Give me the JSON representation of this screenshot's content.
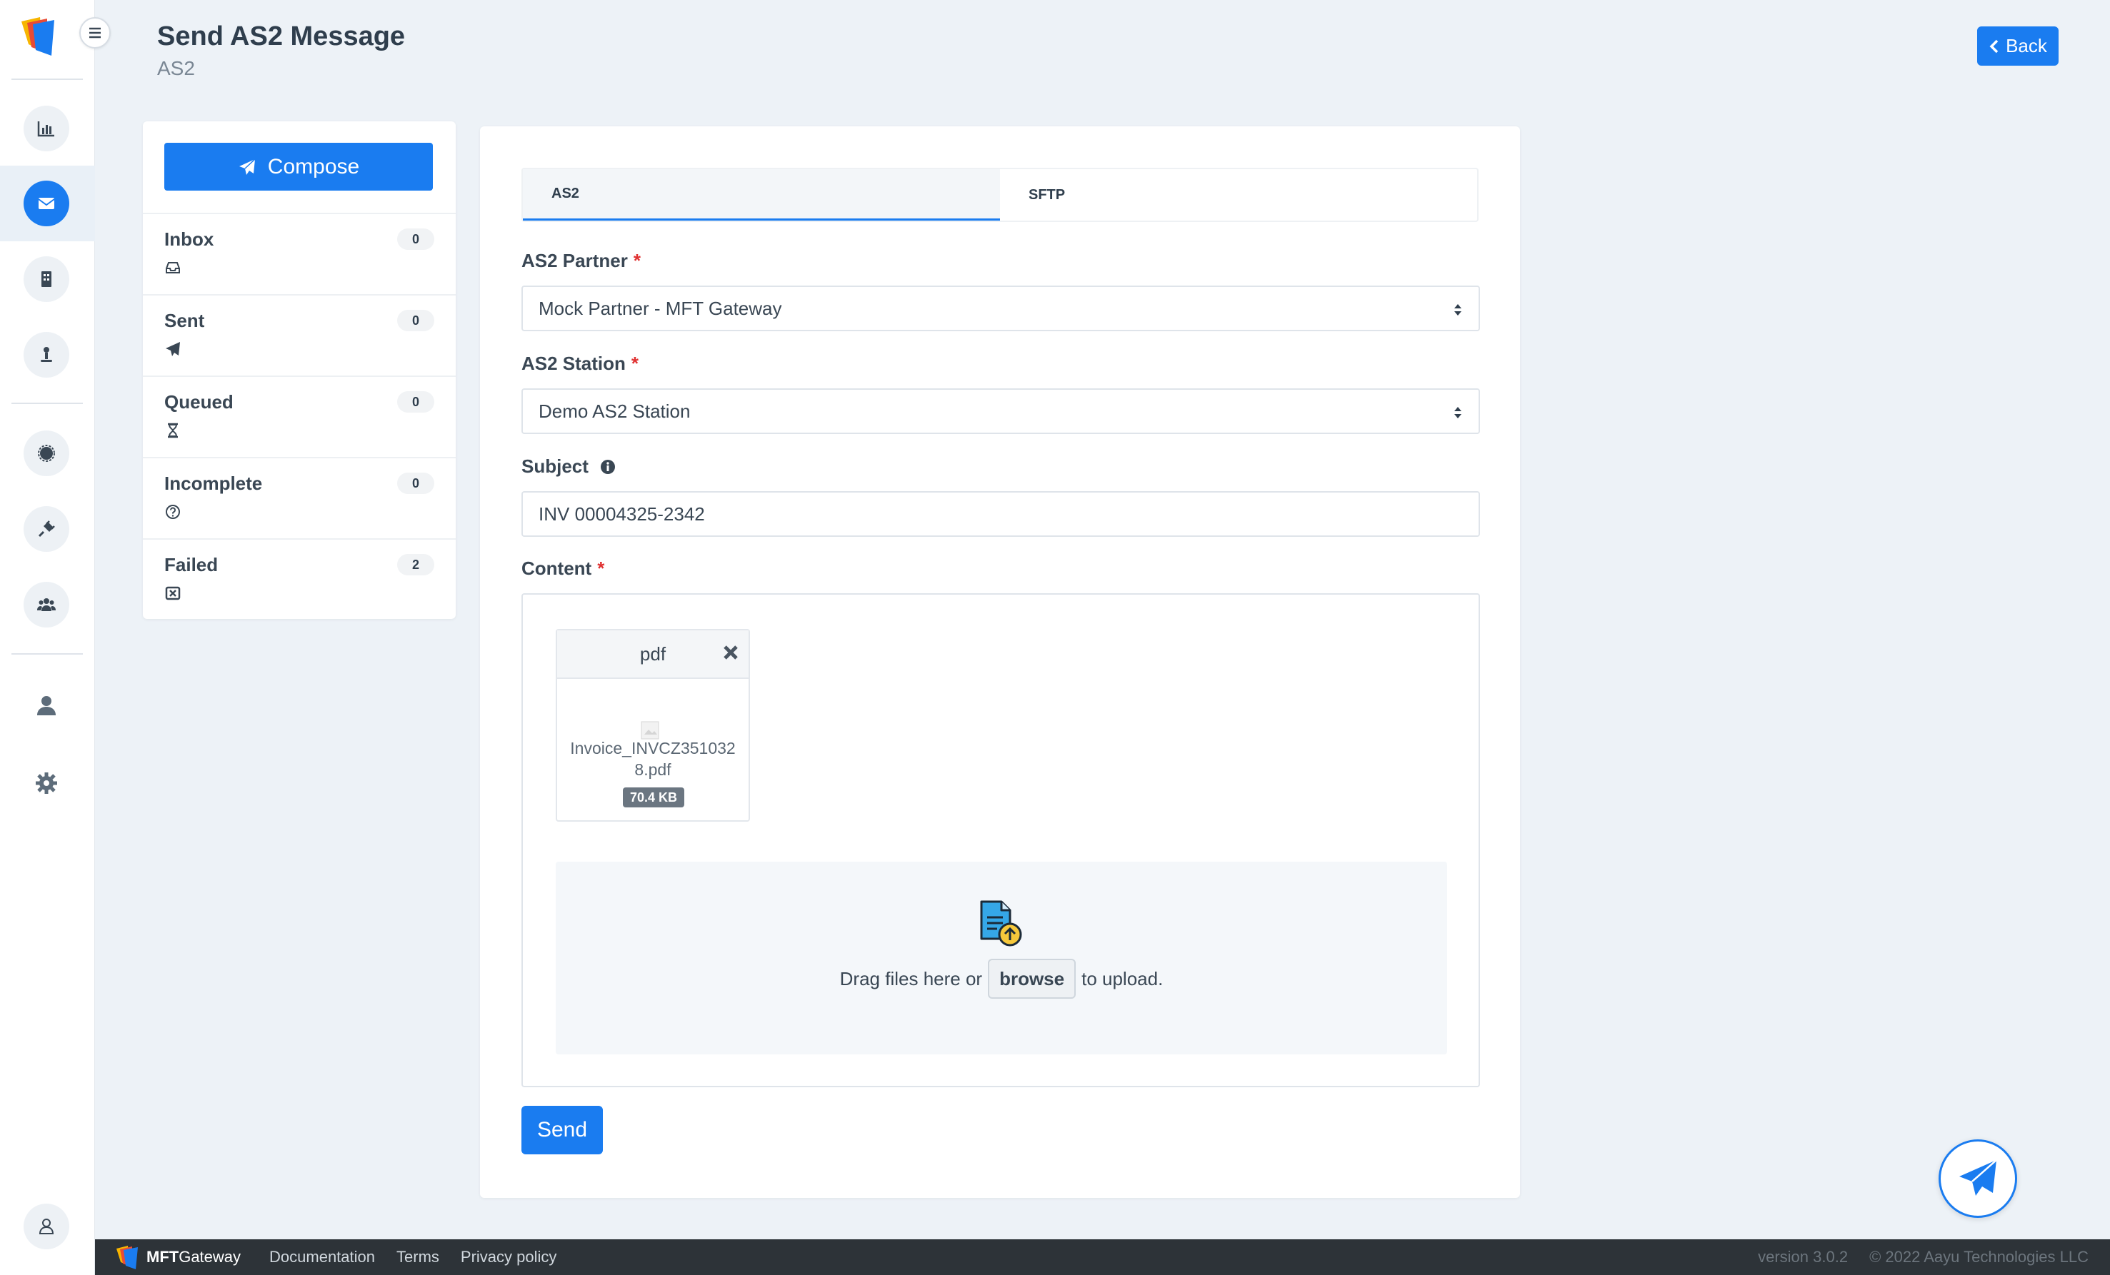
{
  "header": {
    "title": "Send AS2 Message",
    "subtitle": "AS2",
    "back_label": "Back"
  },
  "folders": {
    "compose_label": "Compose",
    "items": [
      {
        "label": "Inbox",
        "count": "0",
        "icon": "inbox-icon"
      },
      {
        "label": "Sent",
        "count": "0",
        "icon": "paper-plane-icon"
      },
      {
        "label": "Queued",
        "count": "0",
        "icon": "hourglass-icon"
      },
      {
        "label": "Incomplete",
        "count": "0",
        "icon": "question-circle-icon"
      },
      {
        "label": "Failed",
        "count": "2",
        "icon": "x-square-icon"
      }
    ]
  },
  "tabs": [
    {
      "label": "AS2",
      "active": true
    },
    {
      "label": "SFTP",
      "active": false
    }
  ],
  "form": {
    "partner_label": "AS2 Partner",
    "partner_value": "Mock Partner - MFT Gateway",
    "station_label": "AS2 Station",
    "station_value": "Demo AS2 Station",
    "subject_label": "Subject",
    "subject_value": "INV 00004325-2342",
    "content_label": "Content",
    "required_mark": "*",
    "file": {
      "type": "pdf",
      "name": "Invoice_INVCZ3510328.pdf",
      "size": "70.4 KB"
    },
    "drop_before": "Drag files here or",
    "browse_label": "browse",
    "drop_after": "to upload.",
    "send_label": "Send"
  },
  "footer": {
    "brand_bold": "MFT",
    "brand_rest": "Gateway",
    "links": [
      "Documentation",
      "Terms",
      "Privacy policy"
    ],
    "version": "version 3.0.2",
    "copyright": "© 2022 Aayu Technologies LLC"
  },
  "colors": {
    "accent": "#1a7cf0",
    "footer_bg": "#2d3338",
    "page_bg": "#edf2f7"
  }
}
